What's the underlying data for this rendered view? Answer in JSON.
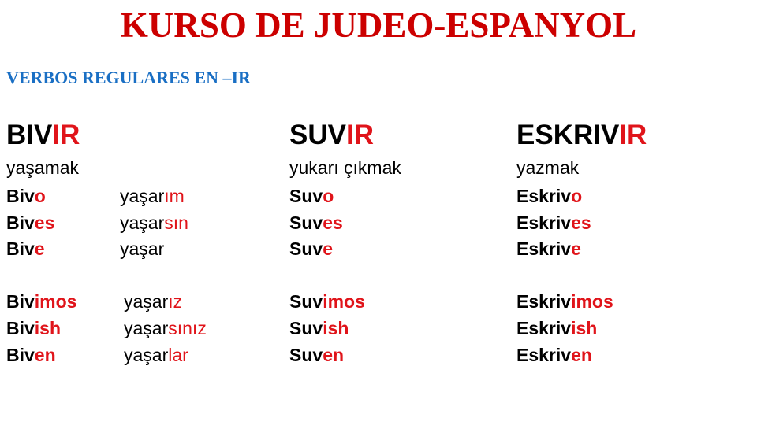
{
  "title": "KURSO DE JUDEO-ESPANYOL",
  "subtitle": "VERBOS REGULARES EN –IR",
  "verbs": [
    {
      "stem": "BIV",
      "ending": "IR",
      "translation": "yaşamak",
      "forms": [
        {
          "stem": "Biv",
          "ending": "o"
        },
        {
          "stem": "Biv",
          "ending": "es"
        },
        {
          "stem": "Biv",
          "ending": "e"
        },
        {
          "stem": "Biv",
          "ending": "imos"
        },
        {
          "stem": "Biv",
          "ending": "ish"
        },
        {
          "stem": "Biv",
          "ending": "en"
        }
      ],
      "turkish": [
        {
          "stem": "yaşar",
          "ending": "ım"
        },
        {
          "stem": "yaşar",
          "ending": "sın"
        },
        {
          "stem": "yaşar",
          "ending": ""
        },
        {
          "stem": "yaşar",
          "ending": "ız"
        },
        {
          "stem": "yaşar",
          "ending": "sınız"
        },
        {
          "stem": "yaşar",
          "ending": "lar"
        }
      ]
    },
    {
      "stem": "SUV",
      "ending": "IR",
      "translation": "yukarı çıkmak",
      "forms": [
        {
          "stem": "Suv",
          "ending": "o"
        },
        {
          "stem": "Suv",
          "ending": "es"
        },
        {
          "stem": "Suv",
          "ending": "e"
        },
        {
          "stem": "Suv",
          "ending": "imos"
        },
        {
          "stem": "Suv",
          "ending": "ish"
        },
        {
          "stem": "Suv",
          "ending": "en"
        }
      ]
    },
    {
      "stem": "ESKRIV",
      "ending": "IR",
      "translation": "yazmak",
      "forms": [
        {
          "stem": "Eskriv",
          "ending": "o"
        },
        {
          "stem": "Eskriv",
          "ending": "es"
        },
        {
          "stem": "Eskriv",
          "ending": "e"
        },
        {
          "stem": "Eskriv",
          "ending": "imos"
        },
        {
          "stem": "Eskriv",
          "ending": "ish"
        },
        {
          "stem": "Eskriv",
          "ending": "en"
        }
      ]
    }
  ],
  "colors": {
    "title": "#cc0000",
    "subtitle": "#1a6fc4",
    "ending": "#e0141a"
  }
}
